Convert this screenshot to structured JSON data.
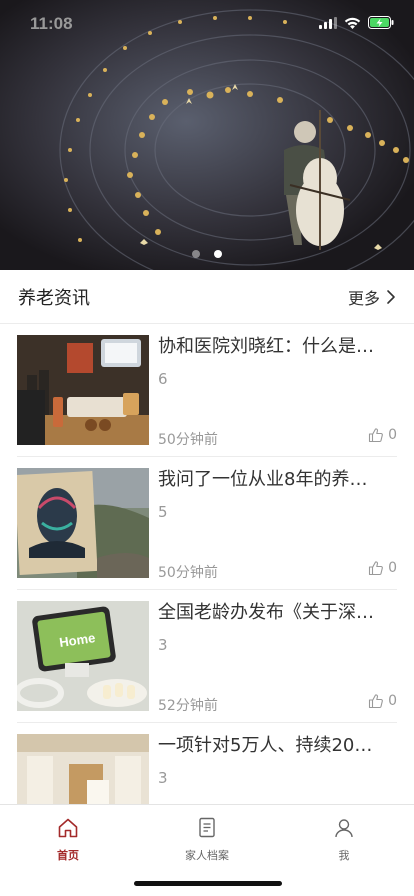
{
  "status_bar": {
    "time": "11:08"
  },
  "banner": {
    "page_count": 2,
    "active_index": 1
  },
  "section": {
    "title": "养老资讯",
    "more_label": "更多"
  },
  "news": [
    {
      "title": "协和医院刘晓红：什么是…",
      "count": "6",
      "time": "50分钟前",
      "likes": "0"
    },
    {
      "title": "我问了一位从业8年的养…",
      "count": "5",
      "time": "50分钟前",
      "likes": "0"
    },
    {
      "title": "全国老龄办发布《关于深…",
      "count": "3",
      "time": "52分钟前",
      "likes": "0"
    },
    {
      "title": "一项针对5万人、持续20…",
      "count": "3",
      "time": "",
      "likes": ""
    }
  ],
  "thumb_text": {
    "item3_screen": "Home"
  },
  "tabbar": {
    "tabs": [
      {
        "label": "首页",
        "icon": "home-icon"
      },
      {
        "label": "家人档案",
        "icon": "document-icon"
      },
      {
        "label": "我",
        "icon": "person-icon"
      }
    ],
    "active_color": "#a32a2a"
  }
}
